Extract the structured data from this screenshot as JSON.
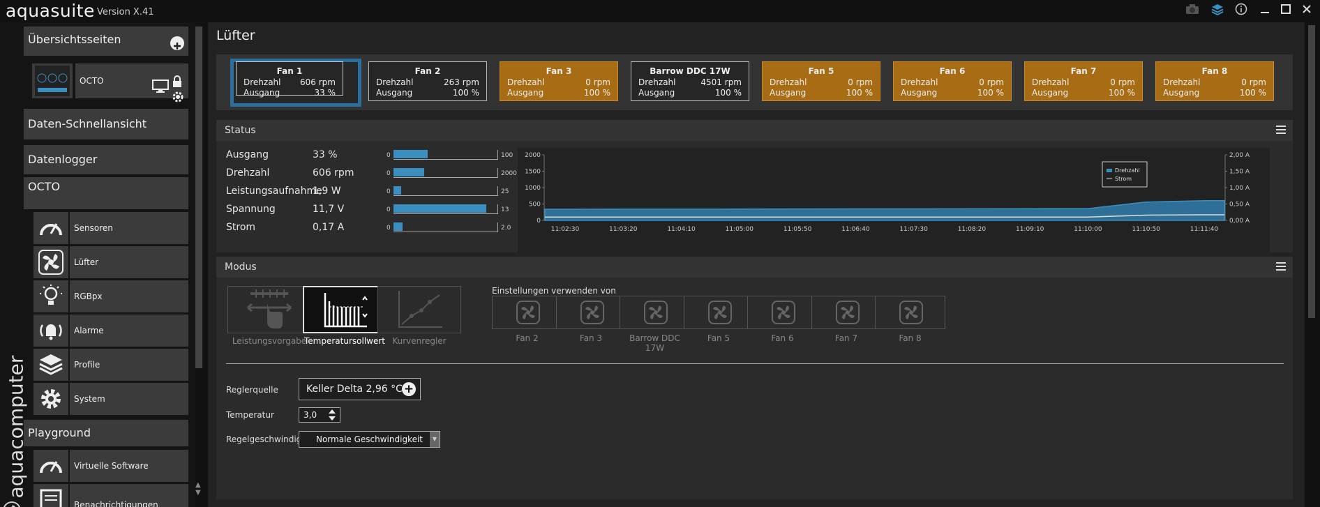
{
  "titlebar": {
    "brand": "aquasuite",
    "version": "Version X.41"
  },
  "sidebar": {
    "vertical_brand": "aquacomputer",
    "overview": "Übersichtsseiten",
    "device_thumb_label": "OCTO",
    "quick_view": "Daten-Schnellansicht",
    "logger": "Datenlogger",
    "device": "OCTO",
    "device_items": [
      "Sensoren",
      "Lüfter",
      "RGBpx",
      "Alarme",
      "Profile",
      "System"
    ],
    "playground": "Playground",
    "playground_items": [
      "Virtuelle Software Sensoren",
      "Benachrichtigungen"
    ]
  },
  "page": {
    "title": "Lüfter"
  },
  "fans": [
    {
      "name": "Fan 1",
      "speed_label": "Drehzahl",
      "speed": "606 rpm",
      "out_label": "Ausgang",
      "out": "33 %"
    },
    {
      "name": "Fan 2",
      "speed_label": "Drehzahl",
      "speed": "263 rpm",
      "out_label": "Ausgang",
      "out": "100 %"
    },
    {
      "name": "Fan 3",
      "speed_label": "Drehzahl",
      "speed": "0 rpm",
      "out_label": "Ausgang",
      "out": "100 %"
    },
    {
      "name": "Barrow DDC 17W",
      "speed_label": "Drehzahl",
      "speed": "4501 rpm",
      "out_label": "Ausgang",
      "out": "100 %"
    },
    {
      "name": "Fan 5",
      "speed_label": "Drehzahl",
      "speed": "0 rpm",
      "out_label": "Ausgang",
      "out": "100 %"
    },
    {
      "name": "Fan 6",
      "speed_label": "Drehzahl",
      "speed": "0 rpm",
      "out_label": "Ausgang",
      "out": "100 %"
    },
    {
      "name": "Fan 7",
      "speed_label": "Drehzahl",
      "speed": "0 rpm",
      "out_label": "Ausgang",
      "out": "100 %"
    },
    {
      "name": "Fan 8",
      "speed_label": "Drehzahl",
      "speed": "0 rpm",
      "out_label": "Ausgang",
      "out": "100 %"
    }
  ],
  "status": {
    "title": "Status",
    "rows": [
      {
        "label": "Ausgang",
        "value": "33 %",
        "min": "0",
        "max": "100",
        "fraction": 0.33
      },
      {
        "label": "Drehzahl",
        "value": "606 rpm",
        "min": "0",
        "max": "2000",
        "fraction": 0.3
      },
      {
        "label": "Leistungsaufnahme",
        "value": "1,9 W",
        "min": "0",
        "max": "25",
        "fraction": 0.076
      },
      {
        "label": "Spannung",
        "value": "11,7 V",
        "min": "0",
        "max": "13",
        "fraction": 0.9
      },
      {
        "label": "Strom",
        "value": "0,17 A",
        "min": "0",
        "max": "2.0",
        "fraction": 0.085
      }
    ]
  },
  "chart_data": {
    "type": "area",
    "x": [
      "11:02:30",
      "11:03:20",
      "11:04:10",
      "11:05:00",
      "11:05:50",
      "11:06:40",
      "11:07:30",
      "11:08:20",
      "11:09:10",
      "11:10:00",
      "11:10:50",
      "11:11:40"
    ],
    "y_left_ticks": [
      "2000",
      "1500",
      "1000",
      "500",
      "0"
    ],
    "y_right_ticks": [
      "2,00 A",
      "1,50 A",
      "1,00 A",
      "0,50 A",
      "0,00 A"
    ],
    "ylim": [
      0,
      2000
    ],
    "ylim_right": [
      0,
      2.0
    ],
    "series": [
      {
        "name": "Drehzahl",
        "values": [
          340,
          342,
          343,
          345,
          348,
          350,
          352,
          354,
          356,
          360,
          560,
          600
        ],
        "color": "#3b8fc0"
      },
      {
        "name": "Strom",
        "values": [
          0.1,
          0.1,
          0.1,
          0.1,
          0.1,
          0.1,
          0.1,
          0.1,
          0.1,
          0.1,
          0.16,
          0.17
        ],
        "color": "#dddddd"
      }
    ],
    "legend": "right"
  },
  "modus": {
    "title": "Modus",
    "modes": [
      "Leistungsvorgabe",
      "Temperatursollwert",
      "Kurvenregler"
    ],
    "use_settings_label": "Einstellungen verwenden von",
    "use_fans": [
      "Fan 2",
      "Fan 3",
      "Barrow DDC 17W",
      "Fan 5",
      "Fan 6",
      "Fan 7",
      "Fan 8"
    ],
    "regler_label": "Reglerquelle",
    "regler_value": "Keller Delta  2,96 °C",
    "temp_label": "Temperatur",
    "temp_value": "3,0",
    "speed_label": "Regelgeschwindigkeit",
    "speed_value": "Normale Geschwindigkeit"
  }
}
